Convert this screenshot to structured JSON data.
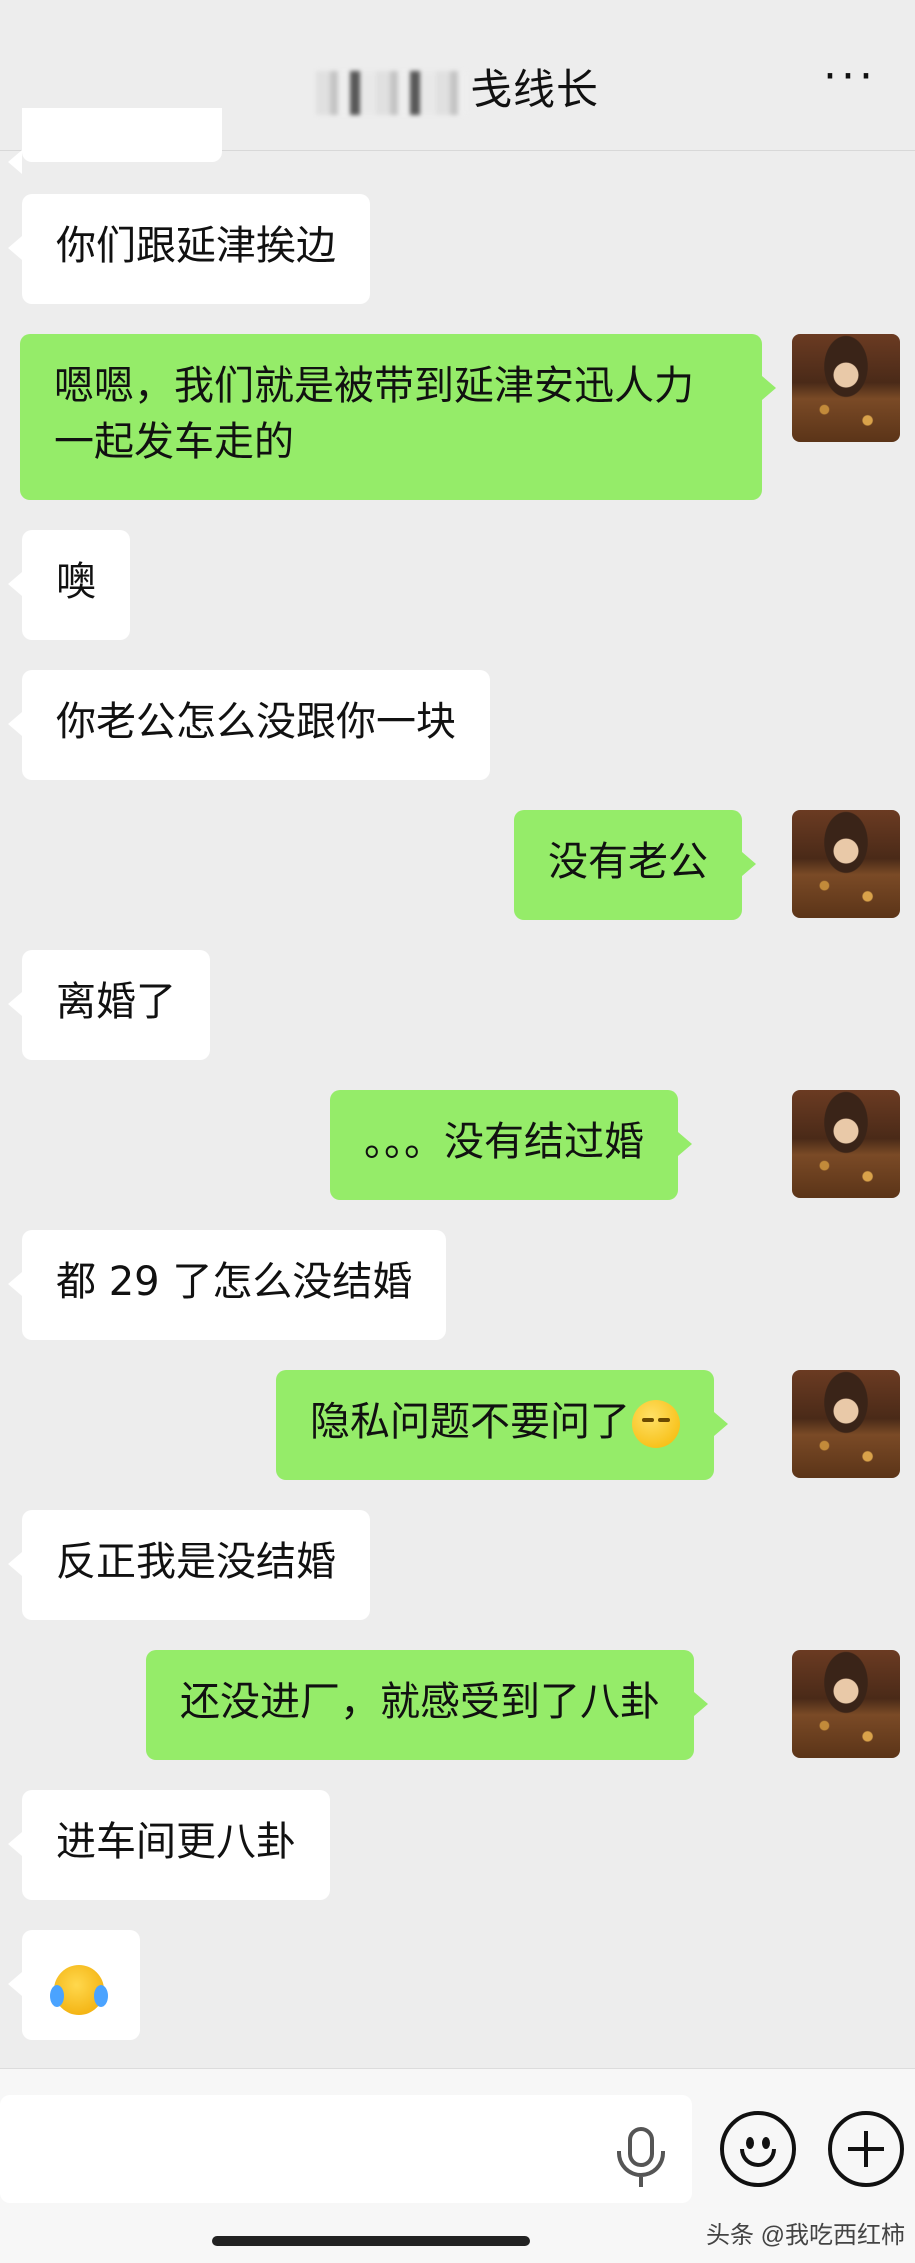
{
  "header": {
    "title_visible": "线长",
    "title_partial": "戋",
    "more_label": "···"
  },
  "messages": [
    {
      "side": "left",
      "text": "你们跟延津挨边"
    },
    {
      "side": "right",
      "text": "嗯嗯，我们就是被带到延津安迅人力一起发车走的"
    },
    {
      "side": "left",
      "text": "噢"
    },
    {
      "side": "left",
      "text": "你老公怎么没跟你一块"
    },
    {
      "side": "right",
      "text": "没有老公"
    },
    {
      "side": "left",
      "text": "离婚了"
    },
    {
      "side": "right",
      "text": "。。。没有结过婚"
    },
    {
      "side": "left",
      "text": "都 29 了怎么没结婚"
    },
    {
      "side": "right",
      "text": "隐私问题不要问了",
      "emoji": "rolling-eyes-emoji"
    },
    {
      "side": "left",
      "text": "反正我是没结婚"
    },
    {
      "side": "right",
      "text": "还没进厂，就感受到了八卦"
    },
    {
      "side": "left",
      "text": "进车间更八卦"
    },
    {
      "side": "left",
      "text": "",
      "emoji": "loudly-crying-emoji"
    }
  ],
  "input_bar": {
    "icons": [
      "microphone-icon",
      "emoji-icon",
      "plus-icon"
    ]
  },
  "watermark": "头条 @我吃西红柿"
}
